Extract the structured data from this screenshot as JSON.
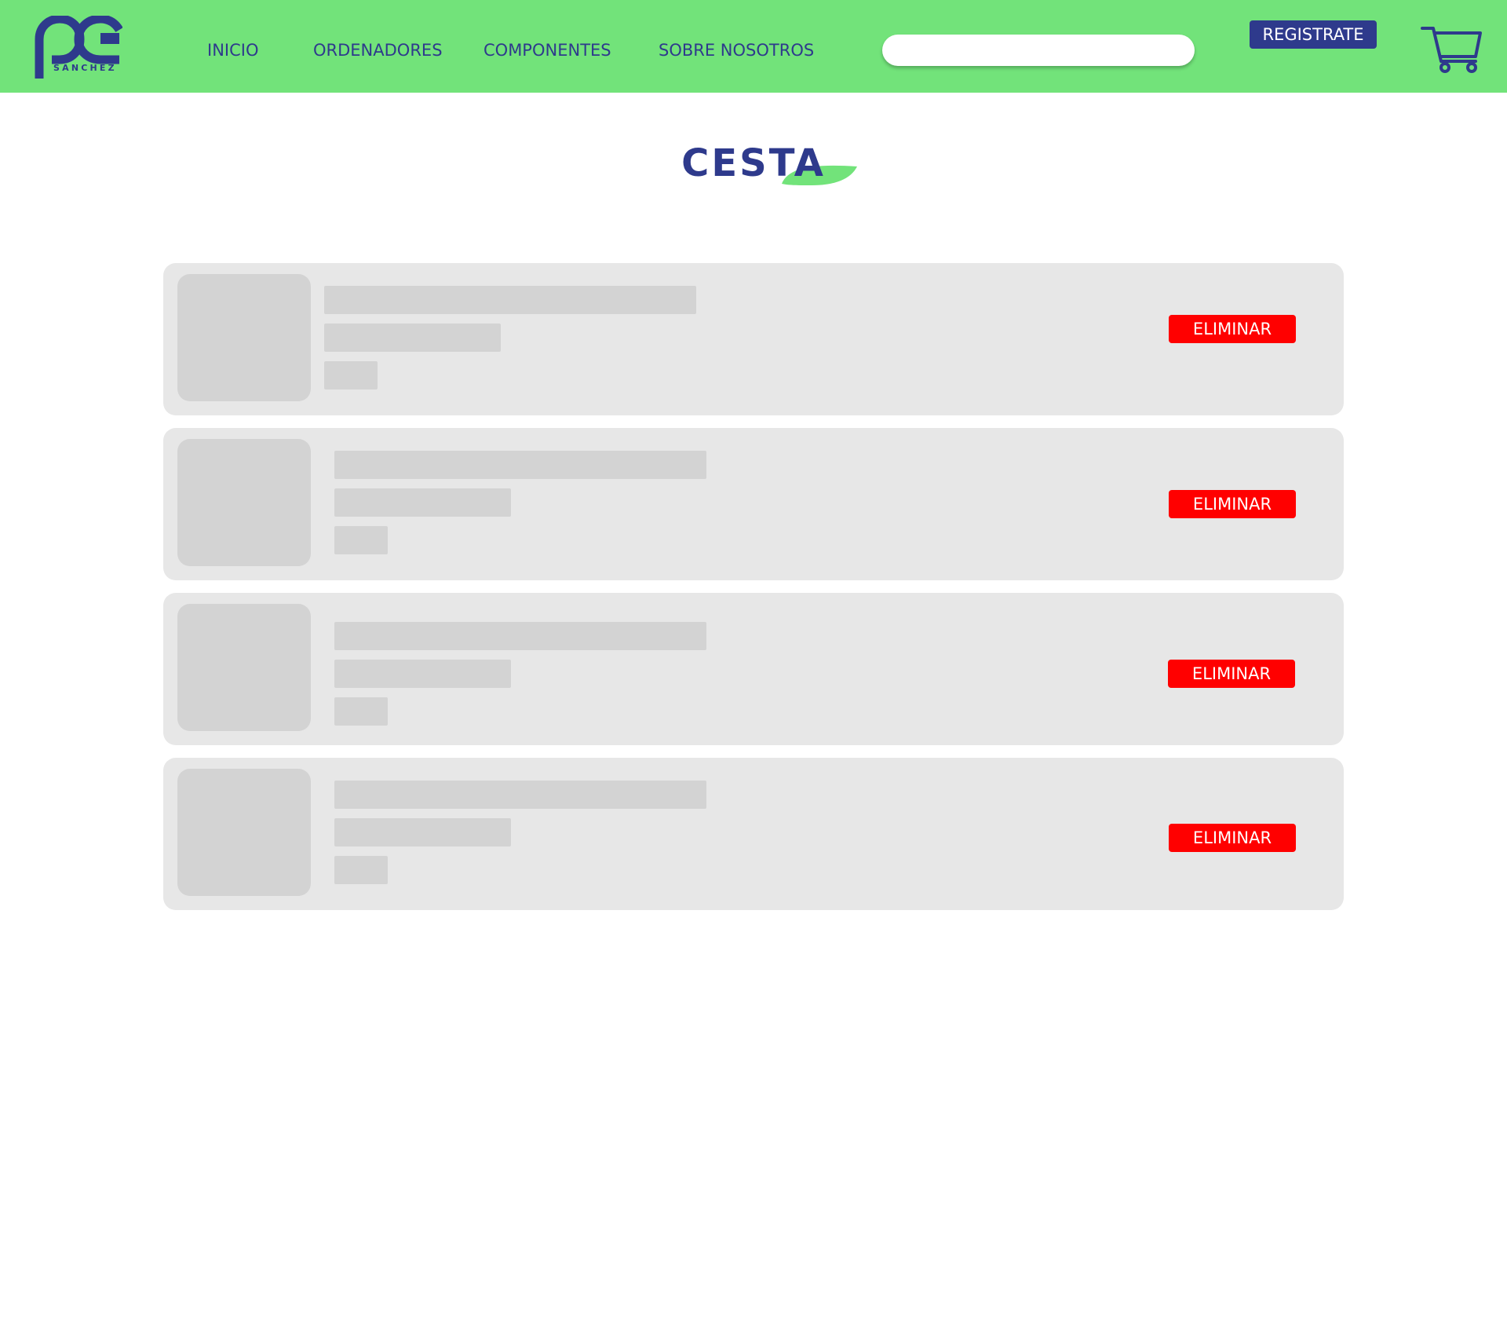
{
  "brand": {
    "logo_letters": "pc",
    "logo_subtitle": "SANCHEZ"
  },
  "nav": {
    "items": [
      {
        "label": "INICIO"
      },
      {
        "label": "ORDENADORES"
      },
      {
        "label": "COMPONENTES"
      },
      {
        "label": "SOBRE NOSOTROS"
      }
    ]
  },
  "search": {
    "value": "",
    "placeholder": ""
  },
  "header": {
    "register_label": "REGISTRATE",
    "cart_icon": "cart-icon"
  },
  "page": {
    "title": "CESTA"
  },
  "cart_items": [
    {
      "delete_label": "ELIMINAR"
    },
    {
      "delete_label": "ELIMINAR"
    },
    {
      "delete_label": "ELIMINAR"
    },
    {
      "delete_label": "ELIMINAR"
    }
  ],
  "colors": {
    "header_bg": "#72e37a",
    "brand_blue": "#2e3a8c",
    "danger": "#ff0000",
    "card_bg": "#e7e7e7",
    "placeholder": "#d3d3d3"
  }
}
